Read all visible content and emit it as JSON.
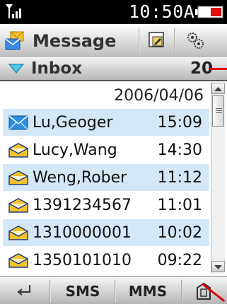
{
  "status": {
    "time": "10:50A",
    "signal_icon": "signal-strength-icon",
    "battery_icon": "battery-icon"
  },
  "titlebar": {
    "title": "Message",
    "app_icon": "message-app-icon",
    "edit_icon": "compose-icon",
    "settings_icon": "settings-gears-icon"
  },
  "folder": {
    "label": "Inbox",
    "count": "20"
  },
  "list": {
    "date": "2006/04/06",
    "items": [
      {
        "name": "Lu,Geoger",
        "time": "15:09",
        "state": "unread"
      },
      {
        "name": "Lucy,Wang",
        "time": "14:30",
        "state": "read"
      },
      {
        "name": "Weng,Rober",
        "time": "11:12",
        "state": "read"
      },
      {
        "name": "1391234567",
        "time": "11:01",
        "state": "read"
      },
      {
        "name": "1310000001",
        "time": "10:02",
        "state": "read"
      },
      {
        "name": "1350101010",
        "time": "09:22",
        "state": "read"
      }
    ]
  },
  "bottombar": {
    "back_icon": "back-arrow-icon",
    "sms": "SMS",
    "mms": "MMS",
    "home_icon": "home-icon"
  },
  "colors": {
    "accent_row": "#d3e7f6",
    "status_bg": "#000000",
    "marker_red": "#e00000"
  }
}
